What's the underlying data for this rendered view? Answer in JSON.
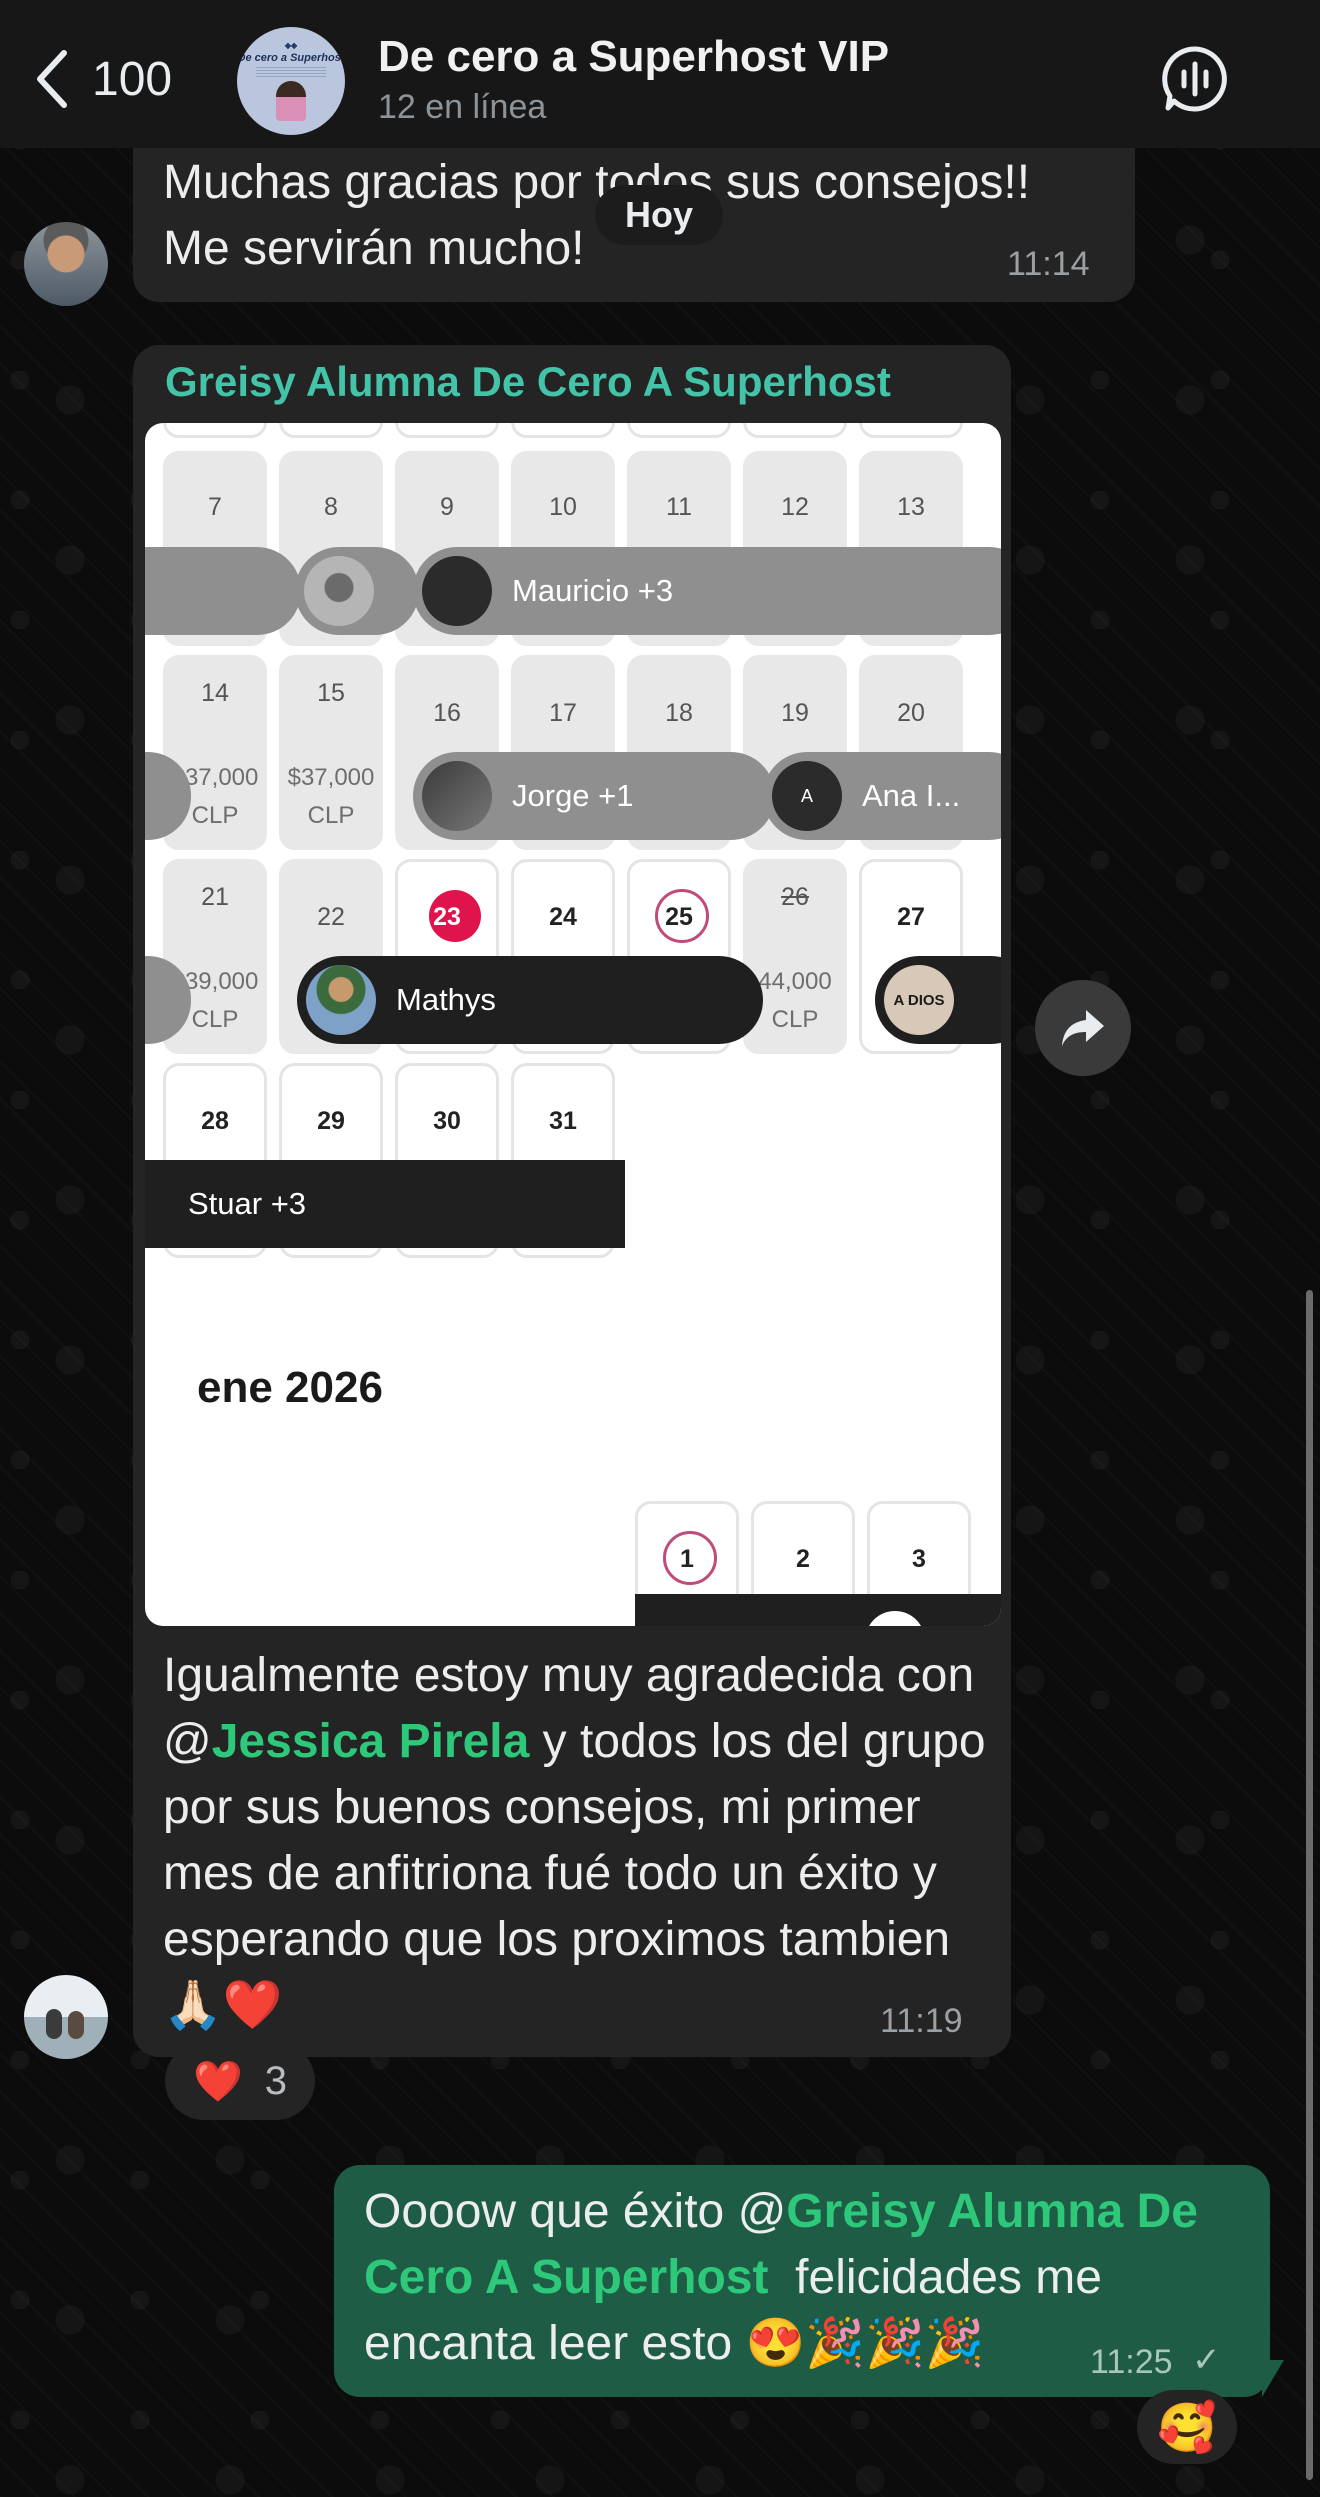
{
  "header": {
    "back_count": "100",
    "group_title": "De cero a Superhost VIP",
    "online_status": "12 en línea",
    "avatar_text": "De cero a Superhost"
  },
  "date_separator": "Hoy",
  "messages": [
    {
      "direction": "incoming",
      "text": "Muchas gracias por todos sus consejos!!\nMe servirán mucho!",
      "time": "11:14"
    },
    {
      "direction": "incoming",
      "sender": "Greisy Alumna De Cero A Superhost",
      "text_before_mention": "Igualmente estoy muy agradecida con @",
      "mention": "Jessica Pirela",
      "text_after_mention": " y todos los del grupo por sus buenos consejos, mi primer mes de anfitriona fué todo un éxito y esperando que los proximos tambien 🙏🏻❤️",
      "time": "11:19",
      "reaction": {
        "emoji": "❤️",
        "count": "3"
      }
    },
    {
      "direction": "outgoing",
      "text_before_mention": "Oooow que éxito @",
      "mention": "Greisy Alumna De Cero A Superhost",
      "text_after_mention": "  felicidades me encanta leer esto 😍🎉🎉🎉",
      "time": "11:25",
      "status": "✓",
      "reaction": "🥰"
    }
  ],
  "calendar": {
    "rows": [
      {
        "days": [
          "7",
          "8",
          "9",
          "10",
          "11",
          "12",
          "13"
        ]
      },
      {
        "days": [
          "14",
          "15",
          "16",
          "17",
          "18",
          "19",
          "20"
        ],
        "prices": [
          "$37,000\nCLP",
          "$37,000\nCLP",
          "",
          "",
          "",
          "",
          ""
        ]
      },
      {
        "days": [
          "21",
          "22",
          "23",
          "24",
          "25",
          "26",
          "27"
        ],
        "prices": [
          "$39,000\nCLP",
          "",
          "",
          "",
          "",
          "44,000\nCLP",
          ""
        ]
      },
      {
        "days": [
          "28",
          "29",
          "30",
          "31"
        ]
      }
    ],
    "bookings": {
      "row1": "Mauricio +3",
      "row2a": "Jorge +1",
      "row2b": "Ana I...",
      "row2b_initial": "A",
      "row3": "Mathys",
      "row3_image_text": "A DIOS",
      "row4": "Stuar +3"
    },
    "next_month": "ene 2026",
    "next_days": [
      "1",
      "2",
      "3"
    ]
  },
  "colors": {
    "incoming_bubble": "#242424",
    "outgoing_bubble": "#1f5c45",
    "mention": "#2ec87a",
    "sender_name": "#43c4a8",
    "today_marker": "#e0144c"
  }
}
